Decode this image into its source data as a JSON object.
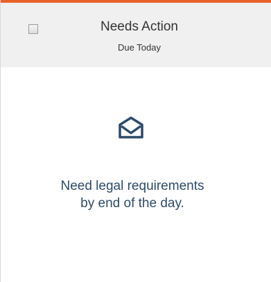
{
  "card": {
    "status": "Needs Action",
    "due": "Due Today",
    "message": "Need legal requirements by end of the day.",
    "icon": "envelope-open-icon",
    "accent_color": "#e8622a",
    "text_color": "#2c4a6b"
  }
}
